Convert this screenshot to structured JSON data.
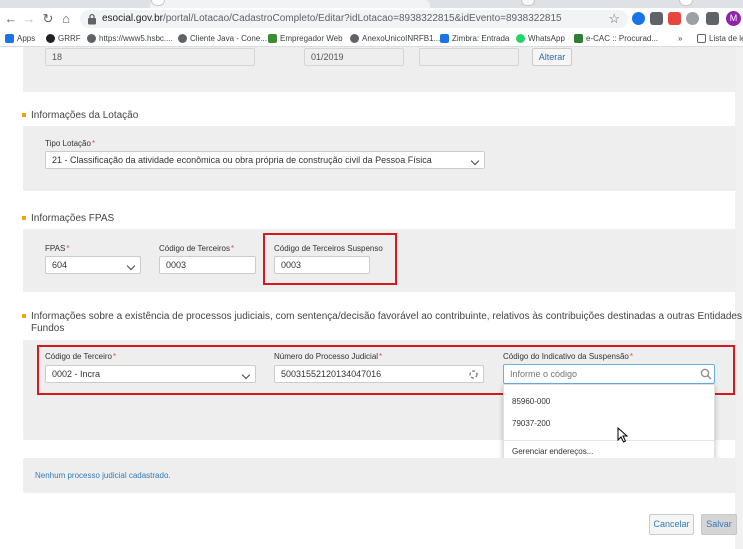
{
  "browser": {
    "url_host": "esocial.gov.br",
    "url_path": "/portal/Lotacao/CadastroCompleto/Editar?idLotacao=8938322815&idEvento=8938322815",
    "bookmarks": [
      {
        "label": "Apps",
        "color": "#1a73e8"
      },
      {
        "label": "GRRF",
        "color": "#202124"
      },
      {
        "label": "https://www5.hsbc....",
        "color": "#5f6368"
      },
      {
        "label": "Cliente Java - Cone...",
        "color": "#5f6368"
      },
      {
        "label": "Empregador Web",
        "color": "#3c8d2f"
      },
      {
        "label": "AnexoUnicoINRFB1...",
        "color": "#5f6368"
      },
      {
        "label": "Zimbra: Entrada",
        "color": "#1a73e8"
      },
      {
        "label": "WhatsApp",
        "color": "#25d366"
      },
      {
        "label": "e-CAC :: Procurad...",
        "color": "#2e7d32"
      }
    ],
    "overflow_label": "»",
    "reading_list_label": "Lista de lei",
    "avatar_letter": "M"
  },
  "top_row": {
    "field1_value": "18",
    "field2_value": "01/2019",
    "field3_value": "",
    "alter_button": "Alterar"
  },
  "lotacao": {
    "section_title": "Informações da Lotação",
    "tipo_label": "Tipo Lotação",
    "tipo_value": "21 - Classificação da atividade econômica ou obra própria de construção civil da Pessoa Física"
  },
  "fpas": {
    "section_title": "Informações FPAS",
    "fpas_label": "FPAS",
    "fpas_value": "604",
    "terceiros_label": "Código de Terceiros",
    "terceiros_value": "0003",
    "suspenso_label": "Código de Terceiros Suspenso",
    "suspenso_value": "0003"
  },
  "processos": {
    "section_title_line1": "Informações sobre a existência de processos judiciais, com sentença/decisão favorável ao contribuinte, relativos às contribuições destinadas a outras Entidades e",
    "section_title_line2": "Fundos",
    "codigo_terceiro_label": "Código de Terceiro",
    "codigo_terceiro_value": "0002 - Incra",
    "numero_processo_label": "Número do Processo Judicial",
    "numero_processo_value": "50031552120134047016",
    "indicativo_label": "Código do Indicativo da Suspensão",
    "indicativo_placeholder": "Informe o código",
    "dropdown_options": [
      "85960-000",
      "79037-200"
    ],
    "dropdown_manage": "Gerenciar endereços...",
    "empty_message": "Nenhum processo judicial cadastrado."
  },
  "footer": {
    "cancel_button": "Cancelar",
    "save_button": "Salvar"
  },
  "required_mark": "*",
  "colors": {
    "highlight": "#d7191c",
    "section_bullet": "#f0a500",
    "link_blue": "#337ab7"
  }
}
